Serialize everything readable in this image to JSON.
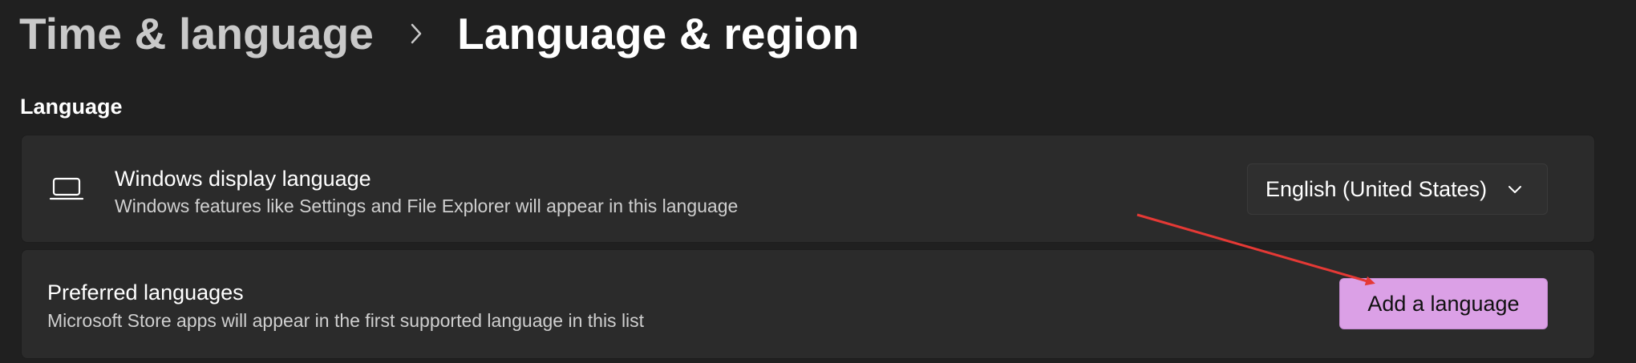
{
  "breadcrumb": {
    "parent": "Time & language",
    "current": "Language & region",
    "separator_icon": "chevron-right-icon"
  },
  "section": {
    "title": "Language"
  },
  "display_language": {
    "icon": "laptop-icon",
    "title": "Windows display language",
    "description": "Windows features like Settings and File Explorer will appear in this language",
    "selected": "English (United States)",
    "dropdown_icon": "chevron-down-icon"
  },
  "preferred_languages": {
    "title": "Preferred languages",
    "description": "Microsoft Store apps will appear in the first supported language in this list",
    "add_button_label": "Add a language"
  },
  "colors": {
    "background": "#202020",
    "card": "#2b2b2b",
    "accent_button": "#dba0e6",
    "annotation_arrow": "#e53935"
  }
}
